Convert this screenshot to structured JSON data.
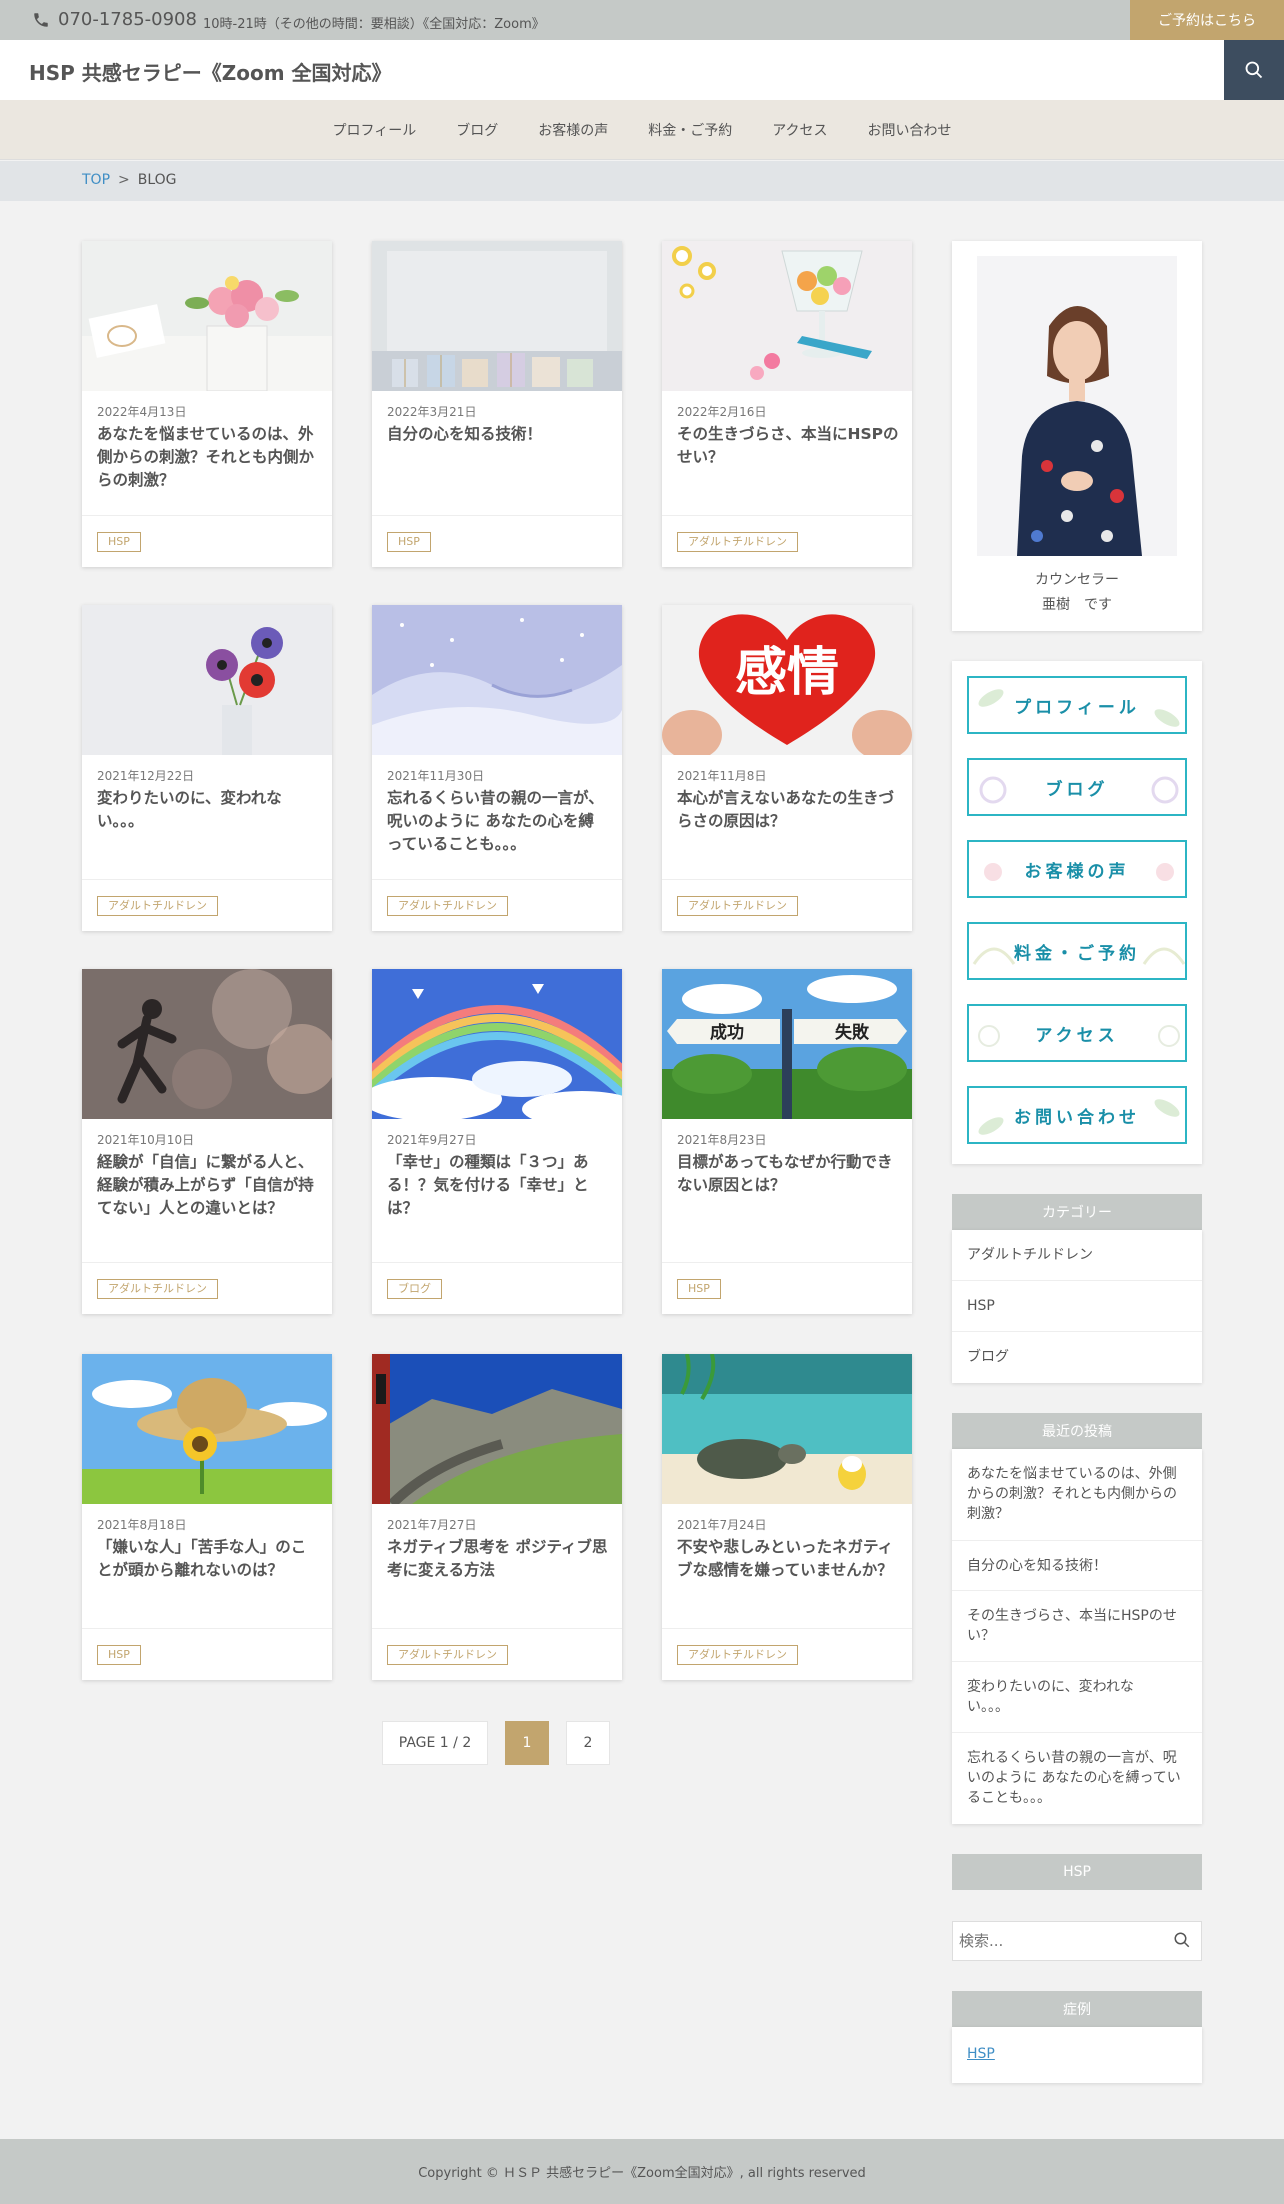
{
  "topbar": {
    "phone": "070-1785-0908",
    "hours": "10時-21時（その他の時間：要相談）《全国対応：Zoom》",
    "reserve": "ご予約はこちら"
  },
  "header": {
    "site_title": "HSP 共感セラピー《Zoom 全国対応》"
  },
  "nav": {
    "items": [
      {
        "label": "プロフィール"
      },
      {
        "label": "ブログ"
      },
      {
        "label": "お客様の声"
      },
      {
        "label": "料金・ご予約"
      },
      {
        "label": "アクセス"
      },
      {
        "label": "お問い合わせ"
      }
    ]
  },
  "breadcrumb": {
    "top": "TOP",
    "sep": ">",
    "current": "BLOG"
  },
  "posts": [
    {
      "date": "2022年4月13日",
      "title": "あなたを悩ませているのは、外側からの刺激？それとも内側からの刺激？",
      "tag": "HSP"
    },
    {
      "date": "2022年3月21日",
      "title": "自分の心を知る技術！",
      "tag": "HSP"
    },
    {
      "date": "2022年2月16日",
      "title": "その生きづらさ、本当にHSPのせい？",
      "tag": "アダルトチルドレン"
    },
    {
      "date": "2021年12月22日",
      "title": "変わりたいのに、変われない。。。",
      "tag": "アダルトチルドレン"
    },
    {
      "date": "2021年11月30日",
      "title": "忘れるくらい昔の親の一言が、呪いのように あなたの心を縛っていることも。。。",
      "tag": "アダルトチルドレン"
    },
    {
      "date": "2021年11月8日",
      "title": "本心が言えないあなたの生きづらさの原因は？",
      "tag": "アダルトチルドレン"
    },
    {
      "date": "2021年10月10日",
      "title": "経験が「自信」に繋がる人と、経験が積み上がらず「自信が持てない」人との違いとは？",
      "tag": "アダルトチルドレン"
    },
    {
      "date": "2021年9月27日",
      "title": "「幸せ」の種類は「３つ」ある！？気を付ける「幸せ」とは？",
      "tag": "ブログ"
    },
    {
      "date": "2021年8月23日",
      "title": "目標があってもなぜか行動できない原因とは？",
      "tag": "HSP"
    },
    {
      "date": "2021年8月18日",
      "title": "「嫌いな人」「苦手な人」のことが頭から離れないのは？",
      "tag": "HSP"
    },
    {
      "date": "2021年7月27日",
      "title": "ネガティブ思考を ポジティブ思考に変える方法",
      "tag": "アダルトチルドレン"
    },
    {
      "date": "2021年7月24日",
      "title": "不安や悲しみといったネガティブな感情を嫌っていませんか？",
      "tag": "アダルトチルドレン"
    }
  ],
  "thumb_text": {
    "kanjo": "感情",
    "success": "成功",
    "failure": "失敗"
  },
  "pager": {
    "label": "PAGE 1 / 2",
    "current": "1",
    "next": "2"
  },
  "sidebar": {
    "profile_caption1": "カウンセラー",
    "profile_caption2": "亜樹　です",
    "menu": [
      "プロフィール",
      "ブログ",
      "お客様の声",
      "料金・ご予約",
      "アクセス",
      "お問い合わせ"
    ],
    "categories_head": "カテゴリー",
    "categories": [
      "アダルトチルドレン",
      "HSP",
      "ブログ"
    ],
    "recent_head": "最近の投稿",
    "recent": [
      "あなたを悩ませているのは、外側からの刺激？それとも内側からの刺激？",
      "自分の心を知る技術！",
      "その生きづらさ、本当にHSPのせい？",
      "変わりたいのに、変われない。。。",
      "忘れるくらい昔の親の一言が、呪いのように あなたの心を縛っていることも。。。"
    ],
    "hsp_head": "HSP",
    "search_placeholder": "検索...",
    "cases_head": "症例",
    "cases_link": "HSP"
  },
  "footer": {
    "copyright": "Copyright © ＨＳＰ 共感セラピー《Zoom全国対応》, all rights reserved"
  },
  "colors": {
    "accent": "#c2a56e",
    "topbar": "#c5c9c7",
    "nav_bg": "#ebe7e0",
    "menu_border": "#2cb5c4",
    "link": "#3f8ec5"
  }
}
